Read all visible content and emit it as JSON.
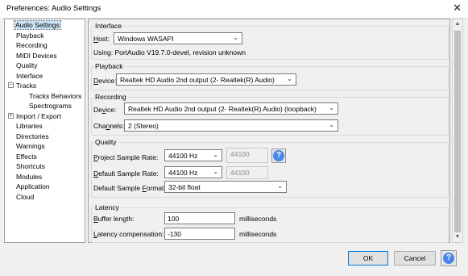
{
  "window": {
    "title": "Preferences: Audio Settings",
    "close_glyph": "✕"
  },
  "tree": [
    {
      "label": "Audio Settings",
      "selected": true
    },
    {
      "label": "Playback"
    },
    {
      "label": "Recording"
    },
    {
      "label": "MIDI Devices"
    },
    {
      "label": "Quality"
    },
    {
      "label": "Interface"
    },
    {
      "label": "Tracks",
      "expander": "−"
    },
    {
      "label": "Tracks Behaviors"
    },
    {
      "label": "Spectrograms"
    },
    {
      "label": "Import / Export",
      "expander": "+"
    },
    {
      "label": "Libraries"
    },
    {
      "label": "Directories"
    },
    {
      "label": "Warnings"
    },
    {
      "label": "Effects"
    },
    {
      "label": "Shortcuts"
    },
    {
      "label": "Modules"
    },
    {
      "label": "Application"
    },
    {
      "label": "Cloud"
    }
  ],
  "interface": {
    "title": "Interface",
    "host_label_u": "H",
    "host_label_rest": "ost:",
    "host_value": "Windows WASAPI",
    "using_text": "Using: PortAudio V19.7.0-devel, revision unknown"
  },
  "playback": {
    "title": "Playback",
    "device_label_u": "D",
    "device_label_rest": "evice:",
    "device_value": "Realtek HD Audio 2nd output (2- Realtek(R) Audio)"
  },
  "recording": {
    "title": "Recording",
    "device_label_pre": "De",
    "device_label_u": "v",
    "device_label_rest": "ice:",
    "device_value": "Realtek HD Audio 2nd output (2- Realtek(R) Audio) (loopback)",
    "channels_label_pre": "Cha",
    "channels_label_u": "n",
    "channels_label_rest": "nels:",
    "channels_value": "2 (Stereo)"
  },
  "quality": {
    "title": "Quality",
    "project_rate_label_u": "P",
    "project_rate_label_rest": "roject Sample Rate:",
    "project_rate_value": "44100 Hz",
    "project_rate_text": "44100",
    "default_rate_label_u": "D",
    "default_rate_label_rest": "efault Sample Rate:",
    "default_rate_value": "44100 Hz",
    "default_rate_text": "44100",
    "default_format_label_pre": "Default Sample ",
    "default_format_label_u": "F",
    "default_format_label_rest": "ormat:",
    "default_format_value": "32-bit float"
  },
  "latency": {
    "title": "Latency",
    "buffer_label_u": "B",
    "buffer_label_rest": "uffer length:",
    "buffer_value": "100",
    "buffer_unit": "milliseconds",
    "comp_label_u": "L",
    "comp_label_rest": "atency compensation:",
    "comp_value": "-130",
    "comp_unit": "milliseconds"
  },
  "buttons": {
    "ok": "OK",
    "cancel": "Cancel",
    "help": "?"
  },
  "icons": {
    "dropdown": "⌄",
    "scroll_up": "▲",
    "scroll_down": "▼",
    "help": "help-icon"
  },
  "colors": {
    "selection": "#cce4f7",
    "help_blue": "#4a86e8"
  }
}
